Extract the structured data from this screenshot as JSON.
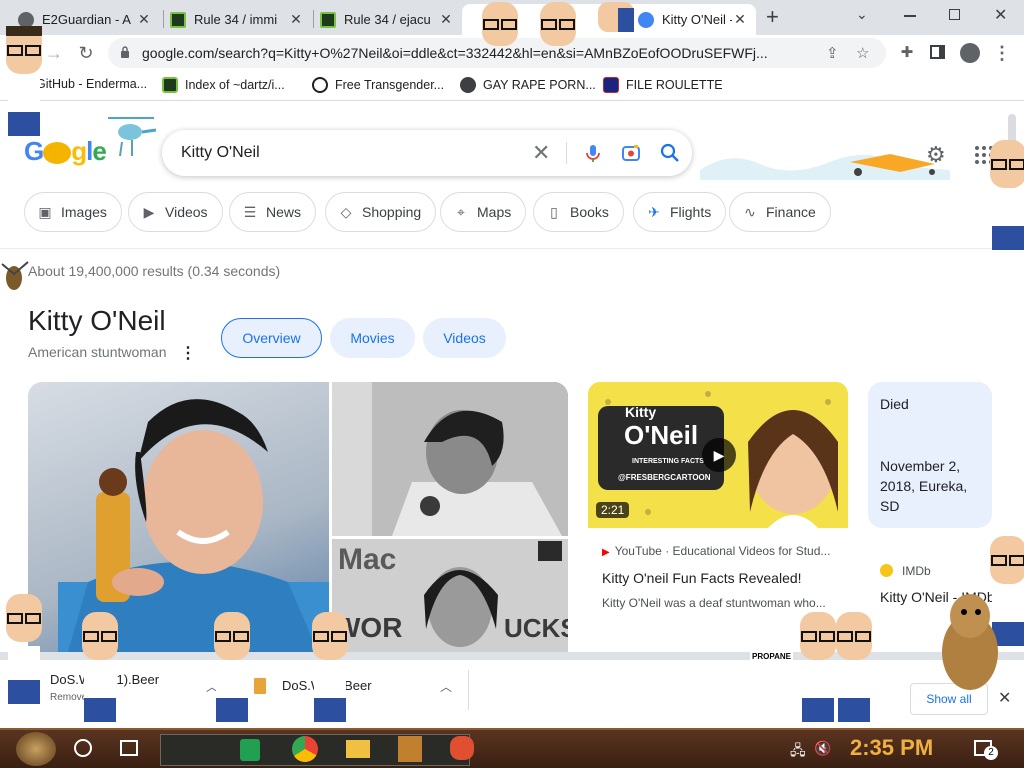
{
  "browser": {
    "tabs": [
      {
        "title": "E2Guardian - A",
        "active": false
      },
      {
        "title": "Rule 34 / immi",
        "active": false
      },
      {
        "title": "Rule 34 / ejacu",
        "active": false
      },
      {
        "title": "Kitty O'Neil - ",
        "active": true
      }
    ],
    "new_tab": "+",
    "url": "google.com/search?q=Kitty+O%27Neil&oi=ddle&ct=332442&hl=en&si=AMnBZoEofOODruSEFWFj...",
    "bookmarks": [
      {
        "label": "GitHub - Enderma..."
      },
      {
        "label": "Index of ~dartz/i..."
      },
      {
        "label": "Free Transgender..."
      },
      {
        "label": "GAY RAPE PORN..."
      },
      {
        "label": "FILE ROULETTE"
      }
    ]
  },
  "google": {
    "query": "Kitty O'Neil",
    "chips": [
      {
        "label": "Images",
        "icon": "image-icon"
      },
      {
        "label": "Videos",
        "icon": "video-icon"
      },
      {
        "label": "News",
        "icon": "news-icon"
      },
      {
        "label": "Shopping",
        "icon": "tag-icon"
      },
      {
        "label": "Maps",
        "icon": "pin-icon"
      },
      {
        "label": "Books",
        "icon": "book-icon"
      },
      {
        "label": "Flights",
        "icon": "plane-icon"
      },
      {
        "label": "Finance",
        "icon": "chart-icon"
      }
    ],
    "stats": "About 19,400,000 results (0.34 seconds)",
    "knowledge_panel": {
      "title": "Kitty O'Neil",
      "subtitle": "American stuntwoman",
      "tabs": [
        {
          "label": "Overview",
          "selected": true
        },
        {
          "label": "Movies",
          "selected": false
        },
        {
          "label": "Videos",
          "selected": false
        }
      ],
      "video": {
        "duration": "2:21",
        "thumb_title_line1": "Kitty",
        "thumb_title_line2": "O'Neil",
        "thumb_caption": "INTERESTING FACTS",
        "thumb_handle": "@FRESBERGCARTOON",
        "source": "YouTube · Educational Videos for Stud...",
        "title": "Kitty O'neil Fun Facts Revealed!",
        "snippet": "Kitty O'Neil was a deaf stuntwoman who..."
      },
      "died": {
        "label": "Died",
        "value": "November 2, 2018, Eureka, SD"
      },
      "imdb": {
        "source": "IMDb",
        "title": "Kitty O'Neil - IMDb"
      }
    }
  },
  "downloads": {
    "items": [
      {
        "name": "DoS.W...2 (1).Beer",
        "status": "Removed"
      },
      {
        "name": "DoS.W...2.Beer",
        "status": ""
      }
    ],
    "show_all": "Show all"
  },
  "taskbar": {
    "clock": "2:35 PM",
    "notification_count": "2",
    "overlay_sign": "PROPANE"
  },
  "colors": {
    "accent": "#1a73e8",
    "chip_bg": "#e8f0fe",
    "taskbar_clock": "#f0b040"
  }
}
